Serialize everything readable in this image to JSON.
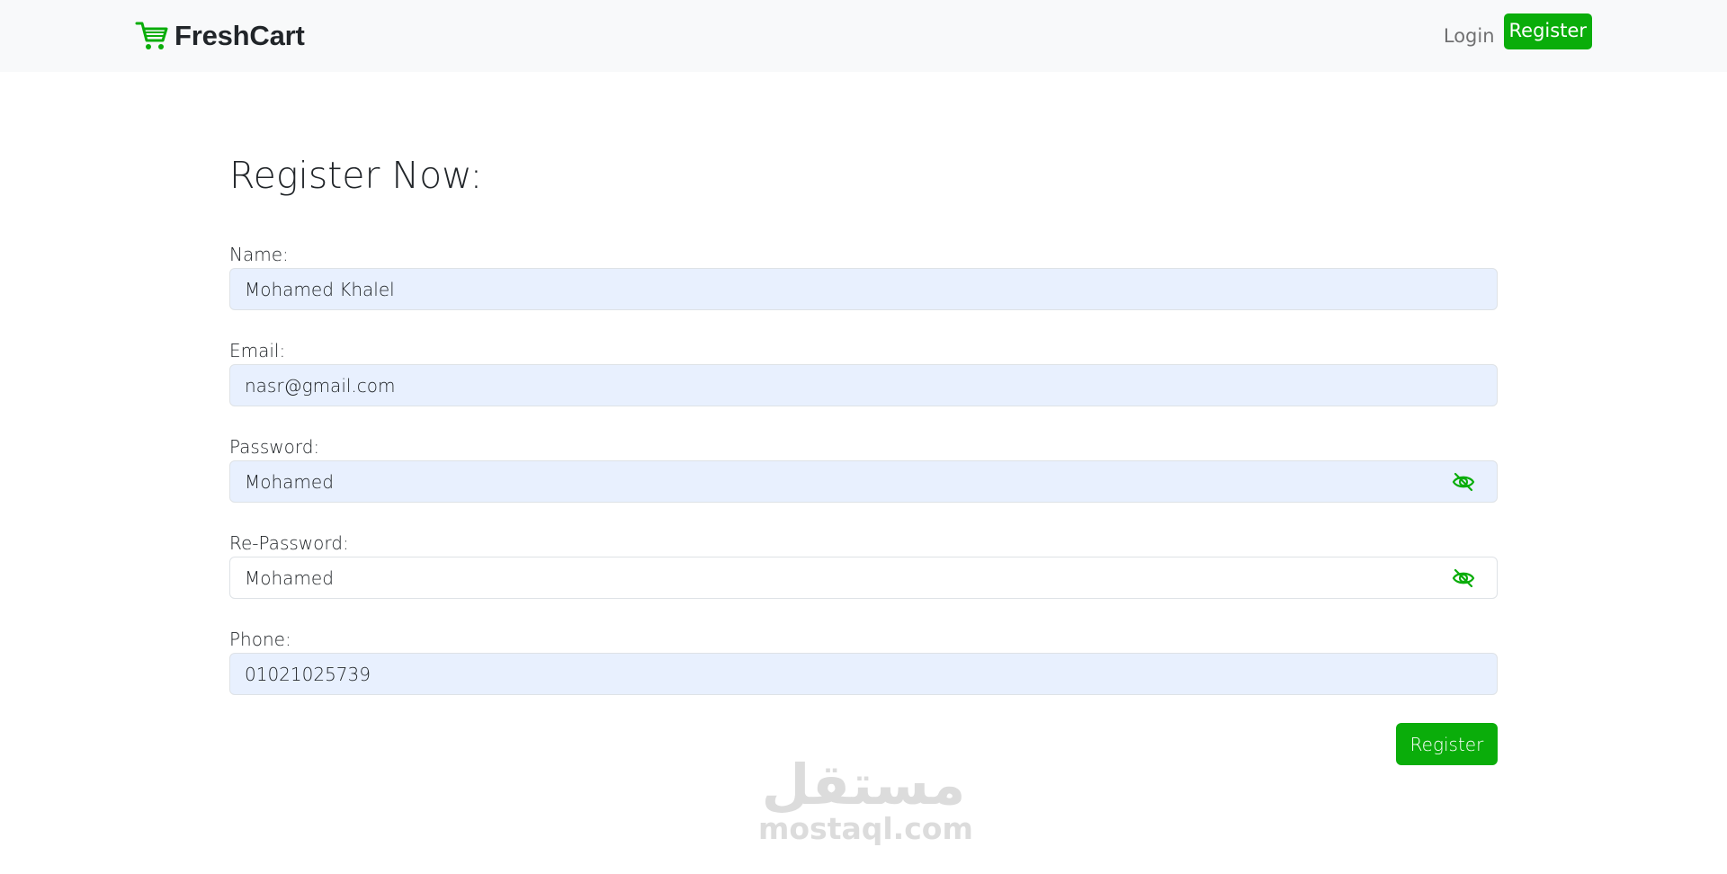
{
  "navbar": {
    "brand": "FreshCart",
    "brand_icon": "shopping-cart-icon",
    "login_label": "Login",
    "register_label": "Register",
    "accent_color": "#0aad0a"
  },
  "form": {
    "title": "Register Now:",
    "name": {
      "label": "Name:",
      "value": "Mohamed Khalel"
    },
    "email": {
      "label": "Email:",
      "value": "nasr@gmail.com"
    },
    "password": {
      "label": "Password:",
      "value": "Mohamed",
      "toggle_icon": "eye-slash-icon"
    },
    "repassword": {
      "label": "Re-Password:",
      "value": "Mohamed",
      "toggle_icon": "eye-slash-icon"
    },
    "phone": {
      "label": "Phone:",
      "value": "01021025739"
    },
    "submit_label": "Register"
  },
  "watermark": {
    "arabic": "مستقل",
    "latin": "mostaql.com"
  }
}
